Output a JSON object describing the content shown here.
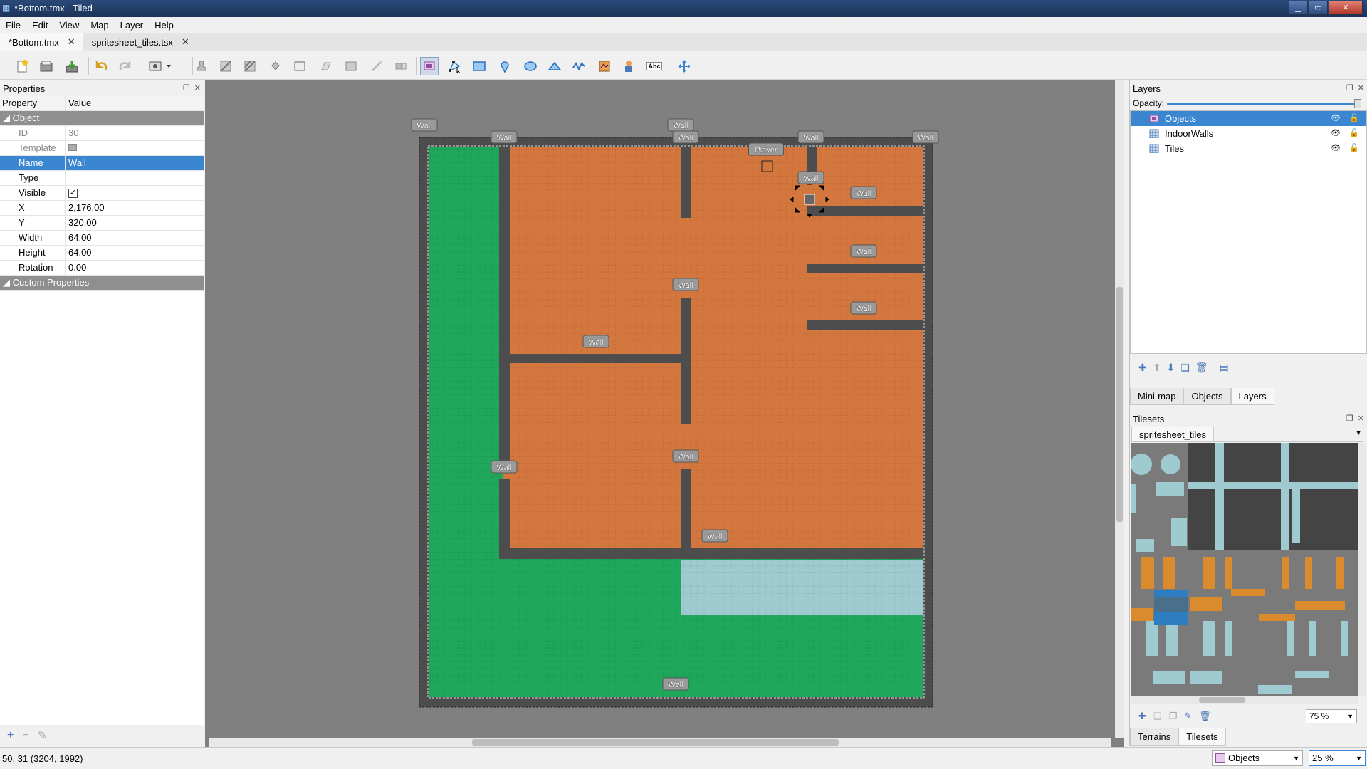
{
  "window": {
    "title": "*Bottom.tmx - Tiled"
  },
  "menu": [
    "File",
    "Edit",
    "View",
    "Map",
    "Layer",
    "Help"
  ],
  "doc_tabs": [
    {
      "label": "*Bottom.tmx",
      "active": true
    },
    {
      "label": "spritesheet_tiles.tsx",
      "active": false
    }
  ],
  "toolbar": {
    "buttons": [
      "new-icon",
      "open-icon",
      "save-icon",
      "undo-icon",
      "redo-icon",
      "command-icon",
      "stamp-icon",
      "terrain-icon",
      "wangbrush-icon",
      "bucket-fill-icon",
      "shape-fill-icon",
      "eraser-icon",
      "rect-select-icon",
      "magic-wand-icon",
      "select-same-tile-icon",
      "select-objects-icon",
      "edit-polygons-icon",
      "insert-rectangle-icon",
      "insert-point-icon",
      "insert-ellipse-icon",
      "insert-polygon-icon",
      "insert-polyline-icon",
      "insert-tile-icon",
      "insert-template-icon",
      "insert-text-icon",
      "move-icon"
    ],
    "text_button": "Abc"
  },
  "properties": {
    "panel_title": "Properties",
    "col_property": "Property",
    "col_value": "Value",
    "group_object": "Object",
    "rows": [
      {
        "key": "ID",
        "value": "30",
        "dim": true
      },
      {
        "key": "Template",
        "value": "",
        "dim": true
      },
      {
        "key": "Name",
        "value": "Wall",
        "selected": true
      },
      {
        "key": "Type",
        "value": ""
      },
      {
        "key": "Visible",
        "value": "✓"
      },
      {
        "key": "X",
        "value": "2,176.00"
      },
      {
        "key": "Y",
        "value": "320.00"
      },
      {
        "key": "Width",
        "value": "64.00"
      },
      {
        "key": "Height",
        "value": "64.00"
      },
      {
        "key": "Rotation",
        "value": "0.00"
      }
    ],
    "group_custom": "Custom Properties"
  },
  "map": {
    "labels": [
      "Wall",
      "Wall",
      "Wall",
      "Wall",
      "Wall",
      "Wall",
      "Player",
      "Wall",
      "Wall",
      "Wall",
      "Wall",
      "Wall",
      "Wall",
      "Wall",
      "Wall",
      "Wall",
      "Wall"
    ]
  },
  "layers": {
    "panel_title": "Layers",
    "opacity_label": "Opacity:",
    "items": [
      {
        "name": "Objects",
        "selected": true,
        "type": "object"
      },
      {
        "name": "IndoorWalls",
        "selected": false,
        "type": "tile"
      },
      {
        "name": "Tiles",
        "selected": false,
        "type": "tile"
      }
    ],
    "bottom_tabs": [
      {
        "label": "Mini-map",
        "active": false
      },
      {
        "label": "Objects",
        "active": false
      },
      {
        "label": "Layers",
        "active": true
      }
    ]
  },
  "tilesets": {
    "panel_title": "Tilesets",
    "tab": "spritesheet_tiles",
    "zoom": "75 %",
    "bottom_tabs": [
      {
        "label": "Terrains",
        "active": false
      },
      {
        "label": "Tilesets",
        "active": true
      }
    ]
  },
  "status": {
    "coords": "50, 31 (3204, 1992)",
    "layer_combo": "Objects",
    "zoom": "25 %"
  },
  "colors": {
    "floor": "#d4773f",
    "grass": "#1fa85c",
    "wall": "#4d4d4d",
    "water": "#9fcad0",
    "selection": "#3a86d0"
  }
}
